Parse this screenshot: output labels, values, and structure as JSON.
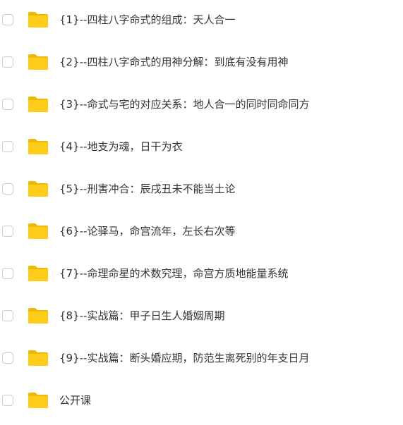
{
  "colors": {
    "folder_back": "#f0b800",
    "folder_front": "#ffcc1a",
    "text": "#333333",
    "checkbox_border": "#c9ced6"
  },
  "icons": {
    "checkbox": "checkbox-unchecked",
    "item": "folder-icon"
  },
  "items": [
    {
      "label": "{1}--四柱八字命式的组成：天人合一"
    },
    {
      "label": "{2}--四柱八字命式的用神分解：到底有没有用神"
    },
    {
      "label": "{3}--命式与宅的对应关系：地人合一的同时同命同方"
    },
    {
      "label": "{4}--地支为魂，日干为衣"
    },
    {
      "label": "{5}--刑害冲合：辰戌丑未不能当土论"
    },
    {
      "label": "{6}--论驿马，命宫流年，左长右次等"
    },
    {
      "label": "{7}--命理命星的术数究理，命宫方质地能量系统"
    },
    {
      "label": "{8}--实战篇：甲子日生人婚姻周期"
    },
    {
      "label": "{9}--实战篇：断头婚应期，防范生离死别的年支日月"
    },
    {
      "label": "公开课"
    }
  ]
}
